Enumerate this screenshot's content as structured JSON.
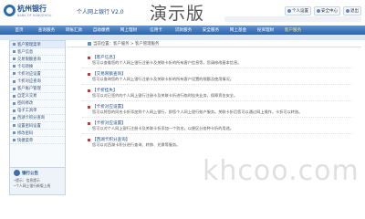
{
  "header": {
    "bank_name": "杭州银行",
    "bank_sub": "BANK OF HANGZHOU",
    "portal_title": "个人网上银行 V2.0",
    "demo_text": "演示版",
    "links": [
      "个人设置",
      "安全中心",
      "退出"
    ]
  },
  "nav": {
    "items": [
      "首页",
      "查询服务",
      "转账汇款",
      "自助缴费",
      "网上理财",
      "信用卡",
      "贷款服务",
      "安全服务",
      "网上基金",
      "投资理财",
      "客户服务"
    ],
    "active_index": 10
  },
  "sidebar": {
    "items": [
      "客户管理菜单",
      "客户信息",
      "交易限额查询",
      "卡号转换",
      "卡折对应设置",
      "卡折对应查询",
      "客户账户管理",
      "自定义交易",
      "密码修改",
      "电子工具单",
      "西湖卡积分查询",
      "设置密码设置",
      "修改密码",
      "快捷菜单"
    ],
    "active_index": 0,
    "notice": {
      "title": "银行公告",
      "lines": [
        "•提示：信息提示",
        "•个人网上银行新版上线"
      ]
    }
  },
  "breadcrumb": {
    "text": "当前位置：客户服务 > 客户管理服务"
  },
  "functions": [
    {
      "title": "【客户信息】",
      "desc": "您可以查看您的个人网上银行注册卡及关联卡折的所有客户信息等，您请修改基本信息。"
    },
    {
      "title": "【交易限额查询】",
      "desc": "您可以查询您的个人网上银行注册卡及关联卡折的所有客户设置的限额及使用情况。"
    },
    {
      "title": "【卡折挂失】",
      "desc": "您可以对已签约的个人网上银行注册卡及关联卡折进行临时挂失业务，保障资金安全。"
    },
    {
      "title": "【卡折对应设置】",
      "desc": "您可以将您的同名卡折添加到个人网上银行，即您个人网上银行账户服务。关联卡折后您可以通过网上操作，卡折可以转账。"
    },
    {
      "title": "【卡折对应设置】",
      "desc": "您可以对个人网上银行注册卡及关联卡折添加一个别名，以便区分各种卡折的用途。"
    },
    {
      "title": "【西湖卡积分查询】",
      "desc": "您可以对西湖卡积分进行查询、转移、兑换等服务。"
    }
  ],
  "watermark": "khcoo.com"
}
